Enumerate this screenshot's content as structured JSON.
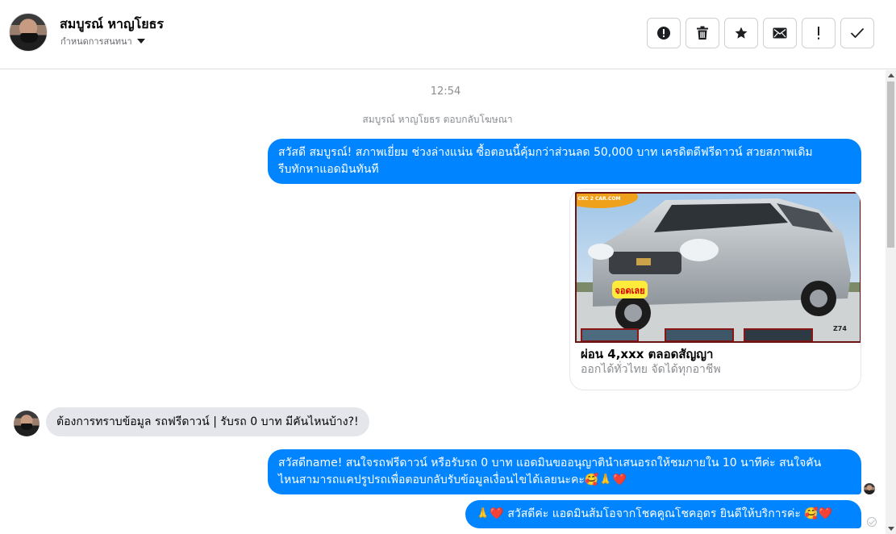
{
  "header": {
    "contact_name": "สมบูรณ์ หาญโยธร",
    "assign_label": "กำหนดการสนทนา",
    "toolbar": [
      {
        "name": "alert-icon",
        "label": "spam"
      },
      {
        "name": "trash-icon",
        "label": "delete"
      },
      {
        "name": "star-icon",
        "label": "star"
      },
      {
        "name": "envelope-icon",
        "label": "mark unread"
      },
      {
        "name": "exclamation-icon",
        "label": "follow up"
      },
      {
        "name": "check-icon",
        "label": "done"
      }
    ]
  },
  "thread": {
    "timestamp": "12:54",
    "reply_note": "สมบูรณ์ หาญโยธร ตอบกลับโฆษณา",
    "messages": [
      {
        "from": "page",
        "text": "สวัสดี สมบูรณ์!  สภาพเยี่ยม ช่วงล่างแน่น  ซื้อตอนนี้คุ้มกว่าส่วนลด 50,000 บาท เครดิตดีฟรีดาวน์  สวยสภาพเดิม\nรีบทักหาแอดมินทันที"
      },
      {
        "from": "page",
        "type": "ad-card",
        "title": "ผ่อน 4,xxx ตลอดสัญญา",
        "subtitle": "ออกได้ทั่วไทย จัดได้ทุกอาชีพ",
        "logo_text": "CKC 2 CAR.COM",
        "sticker_text": "จอดเลย",
        "plate_text": "Z74"
      },
      {
        "from": "customer",
        "text": "ต้องการทราบข้อมูล รถฟรีดาวน์ | รับรถ 0 บาท มีคันไหนบ้าง?!"
      },
      {
        "from": "page",
        "text": "สวัสดีname! สนใจรถฟรีดาวน์ หรือรับรถ 0 บาท แอดมินขออนุญาตินำเสนอรถให้ชมภายใน 10 นาทีค่ะ สนใจคัน\nไหนสามารถแคปรูปรถเพื่อตอบกลับรับข้อมูลเงื่อนไขได้เลยนะคะ🥰🙏❤️"
      },
      {
        "from": "page",
        "text": "🙏❤️ สวัสดีค่ะ แอดมินส้มโอจากโชคคูณโชคอุดร ยินดีให้บริการค่ะ  🥰❤️"
      }
    ]
  },
  "colors": {
    "outgoing": "#0084ff",
    "incoming": "#e4e6eb",
    "muted": "#8a8d91"
  }
}
